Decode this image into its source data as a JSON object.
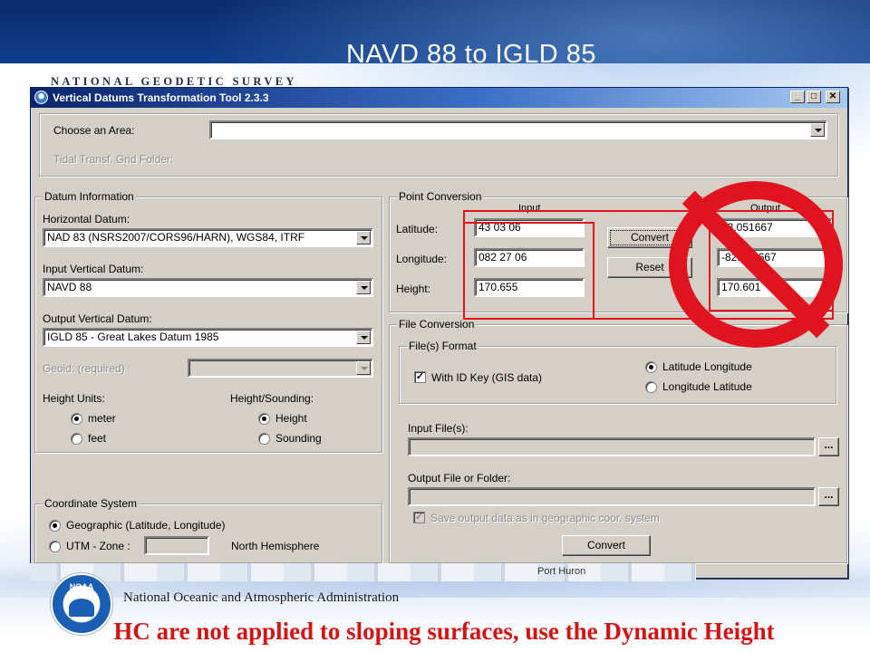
{
  "slide": {
    "title": "NAVD 88 to IGLD 85",
    "banner": "NATIONAL GEODETIC SURVEY",
    "agency": "National Oceanic and Atmospheric Administration",
    "noaa_logo_text": "NOAA",
    "footnote": "HC are not applied to sloping surfaces, use the Dynamic Height",
    "map_label": "Port Huron"
  },
  "window": {
    "title": "Vertical Datums Transformation Tool 2.3.3",
    "controls": {
      "minimize": "_",
      "maximize": "□",
      "close": "✕"
    }
  },
  "area": {
    "choose_label": "Choose an Area:",
    "choose_value": "",
    "grid_folder_label": "Tidal Transf. Grid Folder:"
  },
  "datum": {
    "group_label": "Datum Information",
    "horizontal_label": "Horizontal Datum:",
    "horizontal_value": "NAD 83 (NSRS2007/CORS96/HARN), WGS84, ITRF",
    "input_vertical_label": "Input Vertical Datum:",
    "input_vertical_value": "NAVD 88",
    "output_vertical_label": "Output Vertical Datum:",
    "output_vertical_value": "IGLD 85 - Great Lakes Datum 1985",
    "geoid_label": "Geoid: (required)",
    "geoid_value": "",
    "height_units_label": "Height Units:",
    "units": [
      {
        "label": "meter",
        "selected": true
      },
      {
        "label": "feet",
        "selected": false
      }
    ],
    "height_sounding_label": "Height/Sounding:",
    "height_sounding": [
      {
        "label": "Height",
        "selected": true
      },
      {
        "label": "Sounding",
        "selected": false
      }
    ]
  },
  "coord": {
    "group_label": "Coordinate System",
    "geographic_label": "Geographic (Latitude, Longitude)",
    "geographic_selected": true,
    "utm_label": "UTM - Zone :",
    "utm_selected": false,
    "utm_zone_value": "",
    "hemisphere_label": "North Hemisphere"
  },
  "point": {
    "group_label": "Point Conversion",
    "input_header": "Input",
    "output_header": "Output",
    "latitude_label": "Latitude:",
    "longitude_label": "Longitude:",
    "height_label": "Height:",
    "lat_input": "43 03 06",
    "lon_input": "082 27 06",
    "height_input": "170.655",
    "lat_output": "43.051667",
    "lon_output": "-82.451667",
    "height_output": "170.601",
    "convert_label": "Convert",
    "reset_label": "Reset"
  },
  "file": {
    "group_label": "File Conversion",
    "format_label": "File(s) Format",
    "id_key_label": "With ID Key (GIS data)",
    "id_key_checked": true,
    "order_options": [
      {
        "label": "Latitude  Longitude",
        "selected": true
      },
      {
        "label": "Longitude  Latitude",
        "selected": false
      }
    ],
    "input_files_label": "Input File(s):",
    "input_files_value": "",
    "output_label": "Output File or Folder:",
    "output_value": "",
    "browse_label": "...",
    "save_geo_label": "Save output data as in geographic coor. system",
    "save_geo_checked": true,
    "convert_label": "Convert"
  },
  "colors": {
    "annotation_red": "#e0141e",
    "window_face": "#d4d0c8",
    "titlebar": "#0a246a",
    "footnote_red": "#d21414"
  }
}
